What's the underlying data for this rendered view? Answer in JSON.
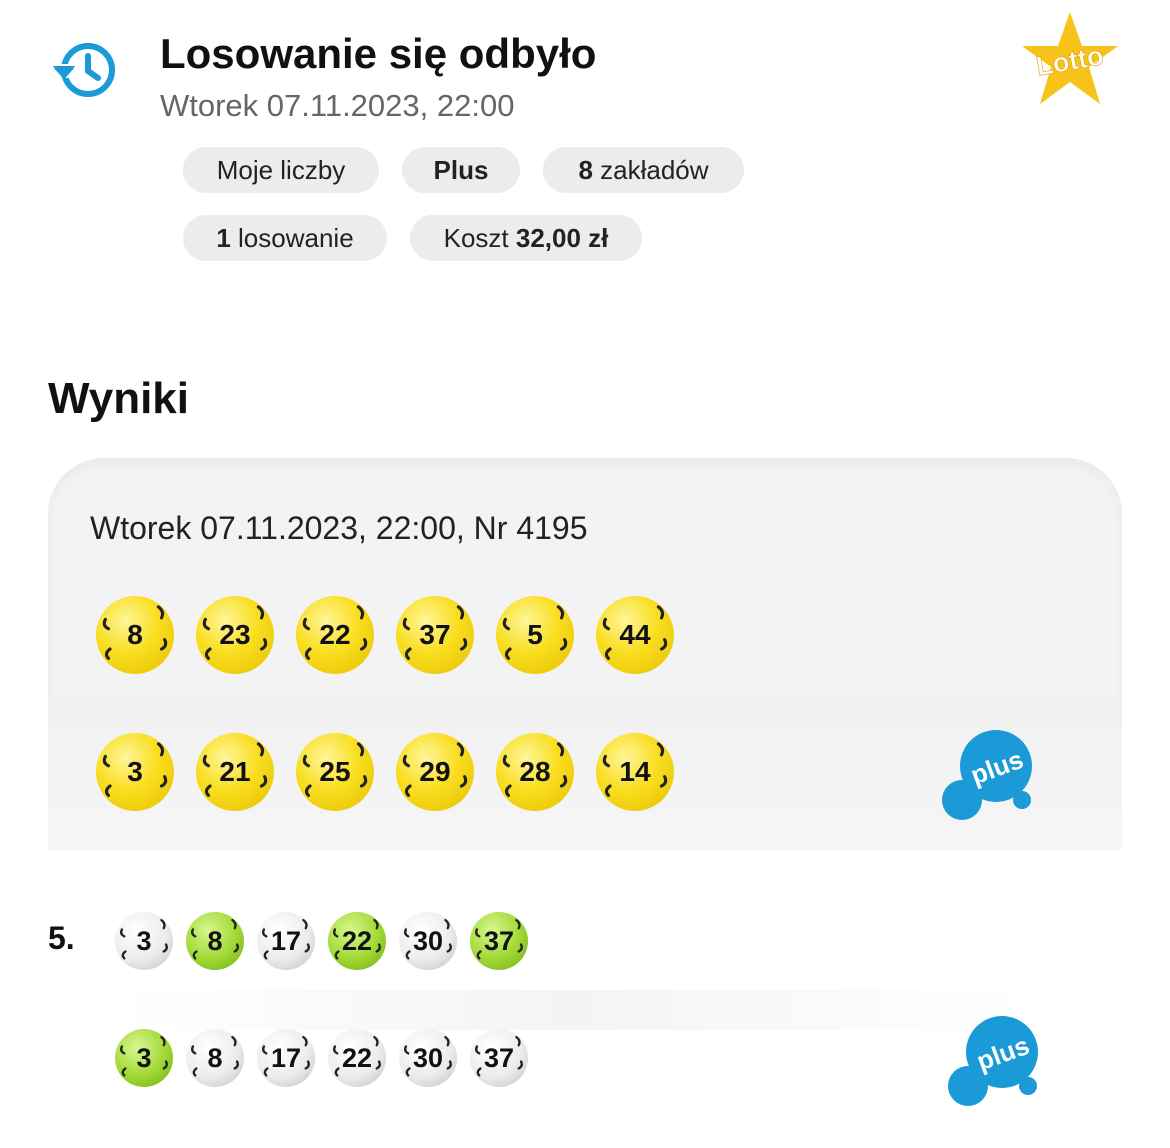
{
  "header": {
    "title": "Losowanie się odbyło",
    "subtitle": "Wtorek 07.11.2023, 22:00",
    "logo_text": "Lotto"
  },
  "chips": {
    "my_numbers": "Moje liczby",
    "plus": "Plus",
    "bets_count": "8",
    "bets_label": "zakładów",
    "draws_count": "1",
    "draws_label": "losowanie",
    "cost_label": "Koszt",
    "cost_value": "32,00 zł"
  },
  "results": {
    "section_title": "Wyniki",
    "draw_label": "Wtorek 07.11.2023, 22:00, Nr 4195",
    "lotto_numbers": [
      "8",
      "23",
      "22",
      "37",
      "5",
      "44"
    ],
    "plus_numbers": [
      "3",
      "21",
      "25",
      "29",
      "28",
      "14"
    ],
    "plus_logo_text": "plus"
  },
  "bet": {
    "index": "5.",
    "lotto_row": [
      {
        "n": "3",
        "hit": false
      },
      {
        "n": "8",
        "hit": true
      },
      {
        "n": "17",
        "hit": false
      },
      {
        "n": "22",
        "hit": true
      },
      {
        "n": "30",
        "hit": false
      },
      {
        "n": "37",
        "hit": true
      }
    ],
    "plus_row": [
      {
        "n": "3",
        "hit": true
      },
      {
        "n": "8",
        "hit": false
      },
      {
        "n": "17",
        "hit": false
      },
      {
        "n": "22",
        "hit": false
      },
      {
        "n": "30",
        "hit": false
      },
      {
        "n": "37",
        "hit": false
      }
    ]
  },
  "colors": {
    "accent_blue": "#1a9ad6",
    "lotto_yellow": "#f9de1f",
    "hit_green": "#9fd833"
  }
}
